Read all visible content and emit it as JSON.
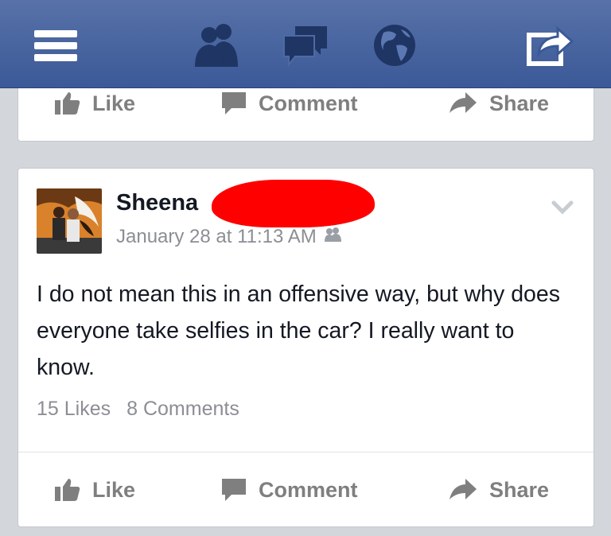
{
  "nav": {
    "icons": [
      "menu-icon",
      "friends-icon",
      "messages-icon",
      "globe-icon",
      "share-icon"
    ]
  },
  "top_post": {
    "actions": {
      "like": "Like",
      "comment": "Comment",
      "share": "Share"
    }
  },
  "post": {
    "author": "Sheena",
    "timestamp": "January 28 at 11:13 AM",
    "privacy_icon": "friends-icon",
    "text": "I do not mean this in an offensive way, but why does everyone take selfies in the car? I really want to know.",
    "likes": "15 Likes",
    "comments": "8 Comments",
    "actions": {
      "like": "Like",
      "comment": "Comment",
      "share": "Share"
    }
  },
  "colors": {
    "header": "#3b5998",
    "redaction": "#ff0000",
    "action_text": "#7f7f7f"
  }
}
